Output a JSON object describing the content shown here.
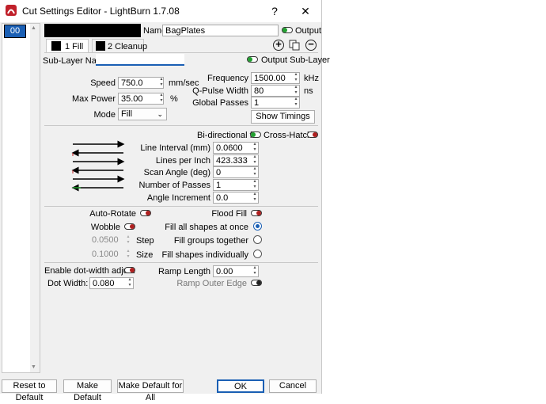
{
  "window": {
    "title": "Cut Settings Editor - LightBurn 1.7.08",
    "help": "?",
    "close": "✕"
  },
  "layers": {
    "selected": "00"
  },
  "header": {
    "name_label": "Name",
    "name_value": "BagPlates",
    "output_label": "Output"
  },
  "tabs": [
    {
      "label": "1 Fill"
    },
    {
      "label": "2 Cleanup"
    }
  ],
  "sublayer": {
    "label": "Sub-Layer Name",
    "value": "",
    "output_label": "Output Sub-Layer"
  },
  "basic": {
    "speed_label": "Speed",
    "speed_value": "750.0",
    "speed_unit": "mm/sec",
    "power_label": "Max Power",
    "power_value": "35.00",
    "power_unit": "%",
    "mode_label": "Mode",
    "mode_value": "Fill",
    "freq_label": "Frequency",
    "freq_value": "1500.00",
    "freq_unit": "kHz",
    "qpulse_label": "Q-Pulse Width",
    "qpulse_value": "80",
    "qpulse_unit": "ns",
    "passes_label": "Global Passes",
    "passes_value": "1",
    "timings_button": "Show Timings"
  },
  "fill": {
    "bidir_label": "Bi-directional fill",
    "crosshatch_label": "Cross-Hatch",
    "interval_label": "Line Interval (mm)",
    "interval_value": "0.0600",
    "lpi_label": "Lines per Inch",
    "lpi_value": "423.333",
    "angle_label": "Scan Angle (deg)",
    "angle_value": "0",
    "npasses_label": "Number of Passes",
    "npasses_value": "1",
    "increment_label": "Angle Increment",
    "increment_value": "0.0"
  },
  "options": {
    "autorotate_label": "Auto-Rotate",
    "flood_label": "Flood Fill",
    "wobble_label": "Wobble",
    "step_value": "0.0500",
    "step_label": "Step",
    "size_value": "0.1000",
    "size_label": "Size",
    "fill_all_label": "Fill all shapes at once",
    "fill_groups_label": "Fill groups together",
    "fill_indiv_label": "Fill shapes individually"
  },
  "dot": {
    "enable_label": "Enable dot-width adjust",
    "width_label": "Dot Width:",
    "width_value": "0.080",
    "ramp_label": "Ramp Length",
    "ramp_value": "0.00",
    "ramp_outer_label": "Ramp Outer Edge"
  },
  "footer": {
    "reset": "Reset to Default",
    "make_default": "Make Default",
    "make_all": "Make Default for All",
    "ok": "OK",
    "cancel": "Cancel"
  },
  "colors": {
    "accent": "#1a5fb4",
    "on": "#22a030",
    "off": "#b02020"
  }
}
